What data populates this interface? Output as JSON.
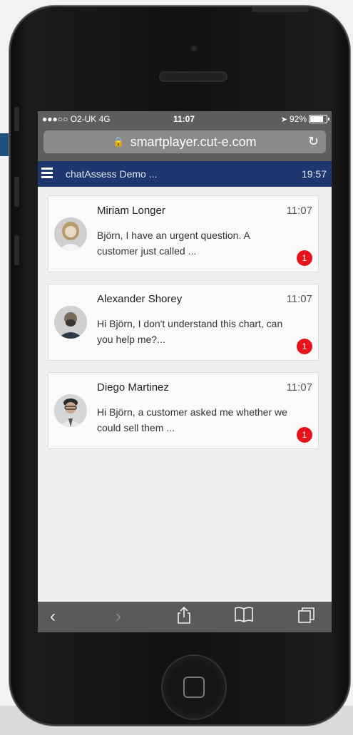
{
  "status_bar": {
    "carrier": "●●●○○ O2-UK  4G",
    "time": "11:07",
    "battery": "92%",
    "battery_level": 0.92
  },
  "browser": {
    "url": "smartplayer.cut-e.com",
    "lock_icon": "lock-icon",
    "reload_icon": "reload-icon"
  },
  "app": {
    "title": "chatAssess Demo ...",
    "clock": "19:57",
    "menu_icon": "hamburger-menu-icon"
  },
  "chats": [
    {
      "name": "Miriam Longer",
      "time": "11:07",
      "message": "Björn, I have an urgent question. A customer just called ...",
      "unread": "1"
    },
    {
      "name": "Alexander Shorey",
      "time": "11:07",
      "message": "Hi Björn, I don't understand this chart, can you help me?...",
      "unread": "1"
    },
    {
      "name": "Diego Martinez",
      "time": "11:07",
      "message": "Hi Björn, a customer asked me whether we could sell them ...",
      "unread": "1"
    }
  ],
  "toolbar": {
    "back": "‹",
    "forward": "›",
    "share_icon": "share-icon",
    "bookmarks_icon": "bookmarks-icon",
    "tabs_icon": "tabs-icon"
  },
  "colors": {
    "app_bar": "#1e3770",
    "badge": "#e8131b",
    "browser_chrome": "#5e5e5e"
  }
}
